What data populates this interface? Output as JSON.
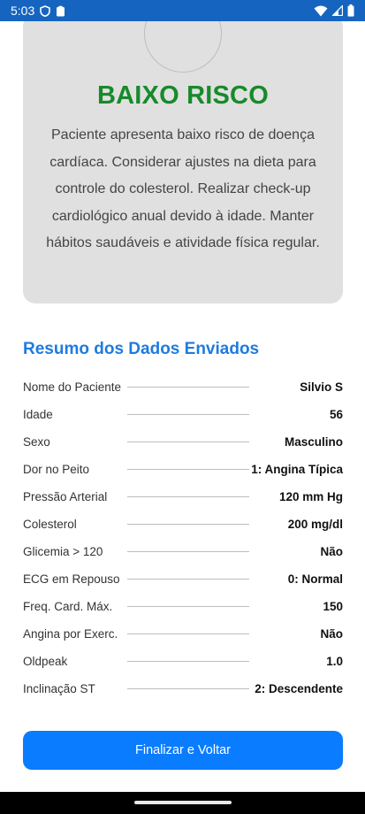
{
  "status_bar": {
    "time": "5:03",
    "left_icons": [
      "vpn-shield-icon",
      "clipboard-icon"
    ],
    "right_icons": [
      "wifi-icon",
      "signal-icon",
      "battery-icon"
    ]
  },
  "risk": {
    "title": "BAIXO RISCO",
    "description": "Paciente apresenta baixo risco de doença cardíaca. Considerar ajustes na dieta para controle do colesterol. Realizar check-up cardiológico anual devido à idade. Manter hábitos saudáveis e atividade física regular.",
    "title_color": "#178a2a"
  },
  "summary": {
    "title": "Resumo dos Dados Enviados",
    "rows": [
      {
        "label": "Nome do Paciente",
        "value": "Silvio S"
      },
      {
        "label": "Idade",
        "value": "56"
      },
      {
        "label": "Sexo",
        "value": "Masculino"
      },
      {
        "label": "Dor no Peito",
        "value": "1: Angina Típica"
      },
      {
        "label": "Pressão Arterial",
        "value": "120 mm Hg"
      },
      {
        "label": "Colesterol",
        "value": "200 mg/dl"
      },
      {
        "label": "Glicemia > 120",
        "value": "Não"
      },
      {
        "label": "ECG em Repouso",
        "value": "0: Normal"
      },
      {
        "label": "Freq. Card. Máx.",
        "value": "150"
      },
      {
        "label": "Angina por Exerc.",
        "value": "Não"
      },
      {
        "label": "Oldpeak",
        "value": "1.0"
      },
      {
        "label": "Inclinação ST",
        "value": "2: Descendente"
      }
    ]
  },
  "actions": {
    "finish_label": "Finalizar e Voltar"
  },
  "colors": {
    "accent": "#0a7cff",
    "status_bar": "#1565c0"
  }
}
